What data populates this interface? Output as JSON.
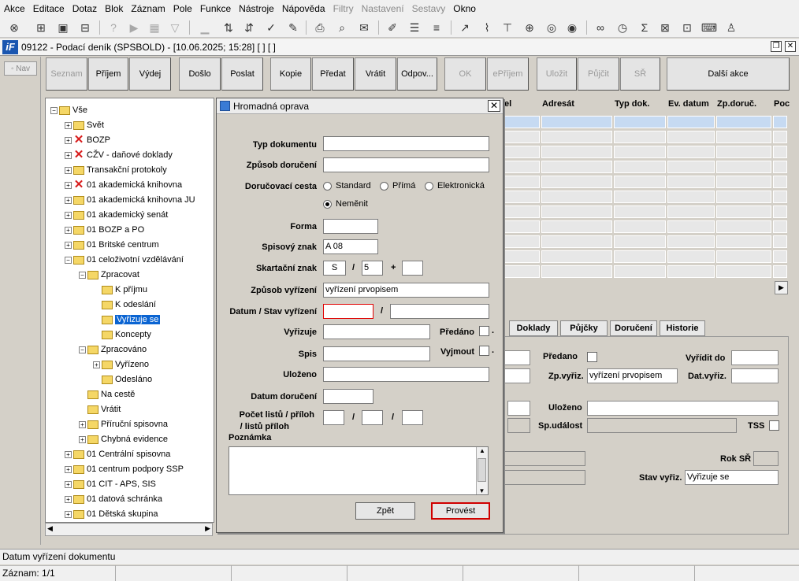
{
  "menubar": {
    "items": [
      {
        "label": "Akce",
        "disabled": false
      },
      {
        "label": "Editace",
        "disabled": false
      },
      {
        "label": "Dotaz",
        "disabled": false
      },
      {
        "label": "Blok",
        "disabled": false
      },
      {
        "label": "Záznam",
        "disabled": false
      },
      {
        "label": "Pole",
        "disabled": false
      },
      {
        "label": "Funkce",
        "disabled": false
      },
      {
        "label": "Nástroje",
        "disabled": false
      },
      {
        "label": "Nápověda",
        "disabled": false
      },
      {
        "label": "Filtry",
        "disabled": true
      },
      {
        "label": "Nastavení",
        "disabled": true
      },
      {
        "label": "Sestavy",
        "disabled": true
      },
      {
        "label": "Okno",
        "disabled": false
      }
    ]
  },
  "window": {
    "title": "09122 - Podací deník (SPSBOLD) - [10.06.2025; 15:28]  [ ]  [ ]",
    "logo": "iF"
  },
  "nav": {
    "label": "Nav"
  },
  "buttons": {
    "seznam": "Seznam",
    "prijem": "Příjem",
    "vydej": "Výdej",
    "doslo": "Došlo",
    "poslat": "Poslat",
    "kopie": "Kopie",
    "predat": "Předat",
    "vratit": "Vrátit",
    "odpov": "Odpov...",
    "ok": "OK",
    "eprijem": "ePříjem",
    "ulozit": "Uložit",
    "pujcit": "Půjčit",
    "sr": "SŘ",
    "dalsi": "Další akce"
  },
  "tree": {
    "nodes": [
      {
        "label": "Vše",
        "icon": "folder"
      },
      {
        "label": "Svět",
        "icon": "folder"
      },
      {
        "label": "BOZP",
        "icon": "red-x"
      },
      {
        "label": "CŽV - daňové doklady",
        "icon": "red-x"
      },
      {
        "label": "Transakční protokoly",
        "icon": "folder"
      },
      {
        "label": "01 akademická knihovna",
        "icon": "red-x"
      },
      {
        "label": "01 akademická knihovna JU",
        "icon": "folder"
      },
      {
        "label": "01 akademický senát",
        "icon": "folder"
      },
      {
        "label": "01 BOZP a PO",
        "icon": "folder"
      },
      {
        "label": "01 Britské centrum",
        "icon": "folder"
      },
      {
        "label": "01 celoživotní vzdělávání",
        "icon": "folder"
      },
      {
        "label": "Zpracovat",
        "icon": "folder"
      },
      {
        "label": "K příjmu",
        "icon": "folder"
      },
      {
        "label": "K odeslání",
        "icon": "folder"
      },
      {
        "label": "Vyřizuje se",
        "icon": "folder",
        "selected": true
      },
      {
        "label": "Koncepty",
        "icon": "folder"
      },
      {
        "label": "Zpracováno",
        "icon": "folder"
      },
      {
        "label": "Vyřízeno",
        "icon": "folder"
      },
      {
        "label": "Odesláno",
        "icon": "folder"
      },
      {
        "label": "Na cestě",
        "icon": "folder"
      },
      {
        "label": "Vrátit",
        "icon": "folder"
      },
      {
        "label": "Příruční spisovna",
        "icon": "folder"
      },
      {
        "label": "Chybná evidence",
        "icon": "folder"
      },
      {
        "label": "01 Centrální spisovna",
        "icon": "folder"
      },
      {
        "label": "01 centrum podpory SSP",
        "icon": "folder"
      },
      {
        "label": "01 CIT - APS, SIS",
        "icon": "folder"
      },
      {
        "label": "01 datová schránka",
        "icon": "folder"
      },
      {
        "label": "01 Dětská skupina",
        "icon": "folder"
      }
    ]
  },
  "grid": {
    "headers": [
      "el",
      "Adresát",
      "Typ dok.",
      "Ev. datum",
      "Zp.doruč.",
      "Poc"
    ]
  },
  "tabs": {
    "doklady": "Doklady",
    "pujcky": "Půjčky",
    "doruceni": "Doručení",
    "historie": "Historie"
  },
  "bottom": {
    "predano_label": "Předano",
    "vyridit_do_label": "Vyřídit do",
    "zpvyriz_label": "Zp.vyřiz.",
    "zpvyriz_value": "vyřízení prvopisem",
    "datvyriz_label": "Dat.vyřiz.",
    "ulozeno_label": "Uloženo",
    "spudalost_label": "Sp.událost",
    "tss_label": "TSS",
    "roksr_label": "Rok SŘ",
    "stavvyriz_label": "Stav vyřiz.",
    "stavvyriz_value": "Vyřizuje se"
  },
  "dialog": {
    "title": "Hromadná oprava",
    "typ_dokumentu": "Typ dokumentu",
    "zpusob_doruceni": "Způsob doručení",
    "dorucovaci_cesta": "Doručovací cesta",
    "radio_standard": "Standard",
    "radio_prima": "Přímá",
    "radio_elektronicka": "Elektronická",
    "radio_nemenit": "Neměnit",
    "forma": "Forma",
    "spisovy_znak": "Spisový znak",
    "spisovy_znak_value": "A 08",
    "skartacni_znak": "Skartační znak",
    "skartacni_s": "S",
    "skartacni_lhuta": "5",
    "slash": "/",
    "plus": "+",
    "zpusob_vyrizeni": "Způsob vyřízení",
    "zpusob_vyrizeni_value": "vyřízení prvopisem",
    "datum_stav_vyrizeni": "Datum / Stav vyřízení",
    "vyrizuje": "Vyřizuje",
    "predano": "Předáno",
    "spis": "Spis",
    "vyjmout": "Vyjmout",
    "dot": ".",
    "ulozeno": "Uloženo",
    "datum_doruceni": "Datum doručení",
    "pocet_listu_1": "Počet listů / příloh",
    "pocet_listu_2": "/ listů příloh",
    "poznamka": "Poznámka",
    "btn_zpet": "Zpět",
    "btn_provest": "Provést"
  },
  "status": {
    "line1": "Datum vyřízení dokumentu",
    "line2": "Záznam: 1/1"
  },
  "colors": {
    "accent": "#0a64d2",
    "error_border": "#e00000",
    "background": "#d4d0c8"
  }
}
